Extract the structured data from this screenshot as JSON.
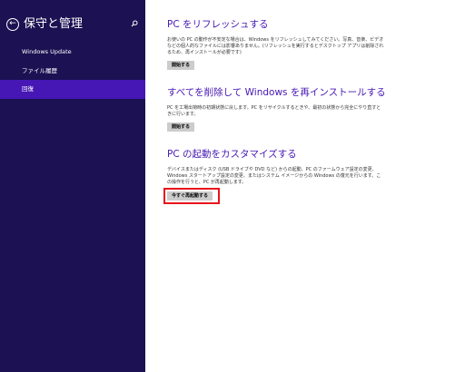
{
  "sidebar": {
    "title": "保守と管理",
    "back_icon": "back-arrow-icon",
    "search_icon": "search-icon",
    "items": [
      {
        "label": "Windows Update"
      },
      {
        "label": "ファイル履歴"
      },
      {
        "label": "回復"
      }
    ],
    "selected_index": 2
  },
  "sections": [
    {
      "title": "PC をリフレッシュする",
      "description": "お使いの PC の動作が不安定な場合は、Windows をリフレッシュしてみてください。写真、音楽、ビデオなどの個人的なファイルには影響ありません。(リフレッシュを実行するとデスクトップ アプリは削除されるため、再インストールが必要です)",
      "button": "開始する"
    },
    {
      "title": "すべてを削除して Windows を再インストールする",
      "description": "PC を工場出荷時の初期状態に戻します。PC をリサイクルするときや、最初の状態から完全にやり直すときに行います。",
      "button": "開始する"
    },
    {
      "title": "PC の起動をカスタマイズする",
      "description": "デバイスまたはディスク (USB ドライブや DVD など) からの起動、PC のファームウェア設定の変更、Windows スタートアップ設定の変更、またはシステム イメージからの Windows の復元を行います。この操作を行うと、PC が再起動します。",
      "button": "今すぐ再起動する"
    }
  ],
  "colors": {
    "sidebar_bg": "#1c1152",
    "selected_bg": "#4617b4",
    "accent_title": "#4617b4",
    "button_bg": "#cccccc",
    "highlight": "#e8131b"
  }
}
